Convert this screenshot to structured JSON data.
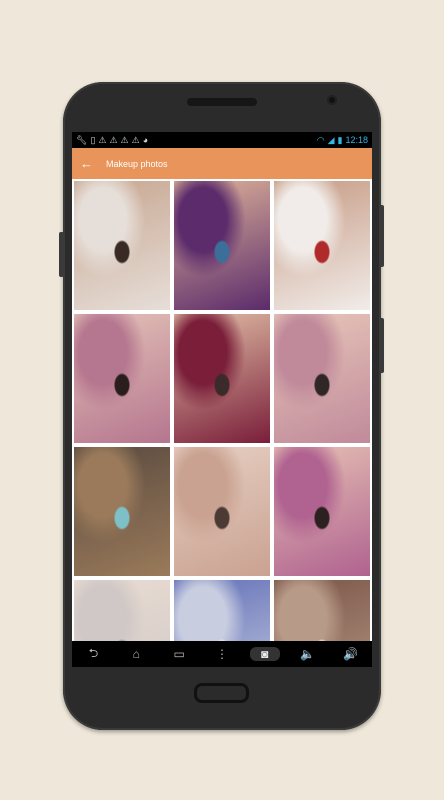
{
  "status": {
    "time": "12:18",
    "left_icons": [
      "wrench-icon",
      "sd-card-icon",
      "warning-icon",
      "warning-icon",
      "warning-icon",
      "warning-icon",
      "gamepad-icon"
    ],
    "right_icons": [
      "wifi-icon",
      "signal-icon",
      "battery-icon"
    ]
  },
  "appbar": {
    "back_glyph": "←",
    "title": "Makeup photos"
  },
  "nav": {
    "items": [
      {
        "glyph": "⮌",
        "icon": "back-nav-icon"
      },
      {
        "glyph": "⌂",
        "icon": "home-nav-icon"
      },
      {
        "glyph": "▭",
        "icon": "recents-nav-icon"
      },
      {
        "glyph": "⋮",
        "icon": "menu-nav-icon"
      },
      {
        "glyph": "◙",
        "icon": "screenshot-nav-icon"
      },
      {
        "glyph": "🔈",
        "icon": "volume-down-icon"
      },
      {
        "glyph": "🔊",
        "icon": "volume-up-icon"
      }
    ]
  },
  "photos": [
    {
      "name": "photo-woman-long-hair",
      "colors": [
        "#e6ded8",
        "#c7a58f",
        "#3a2a25"
      ]
    },
    {
      "name": "photo-purple-lips-blue-eyes",
      "colors": [
        "#5b2b6b",
        "#e0b49a",
        "#3b6f9a"
      ]
    },
    {
      "name": "photo-bride-veil",
      "colors": [
        "#f1ece9",
        "#c69a83",
        "#b02a2a"
      ]
    },
    {
      "name": "photo-pink-eyeshadow",
      "colors": [
        "#b5768f",
        "#e4c2b7",
        "#2a1d1d"
      ]
    },
    {
      "name": "photo-dark-lips-eyes",
      "colors": [
        "#7a1e3a",
        "#e2c0a7",
        "#3b2a2a"
      ]
    },
    {
      "name": "photo-pink-smokey-eye",
      "colors": [
        "#c08a9b",
        "#e8c7b8",
        "#2f2626"
      ]
    },
    {
      "name": "photo-gold-glitter-eye",
      "colors": [
        "#9a7a5a",
        "#5a4a40",
        "#7dc0c7"
      ]
    },
    {
      "name": "photo-nude-lips-eyes",
      "colors": [
        "#caa291",
        "#e6cfc3",
        "#4c3a34"
      ]
    },
    {
      "name": "photo-pink-lips-lashes",
      "colors": [
        "#b06290",
        "#e6c1b3",
        "#2c2020"
      ]
    },
    {
      "name": "photo-silver-glitter-brow",
      "colors": [
        "#d0c8c6",
        "#e9dcd2",
        "#999"
      ]
    },
    {
      "name": "photo-blonde-blue-eye",
      "colors": [
        "#c8cde0",
        "#6270b8",
        "#e6e6ef"
      ]
    },
    {
      "name": "photo-salon-room",
      "colors": [
        "#b89a88",
        "#7a5548",
        "#e8ddd2"
      ]
    }
  ]
}
